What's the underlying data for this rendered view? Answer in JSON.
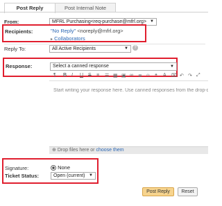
{
  "tabs": [
    {
      "label": "Post Reply",
      "active": true
    },
    {
      "label": "Post Internal Note",
      "active": false
    }
  ],
  "from": {
    "label": "From:",
    "value": "MFRL Purchasing<req-purchase@mfrl.org>"
  },
  "recipients": {
    "label": "Recipients:",
    "name": "\"No Reply\"",
    "email": "<noreply@mfrl.org>",
    "collaborators": "Collaborators"
  },
  "reply_to": {
    "label": "Reply To:",
    "value": "All Active Recipients"
  },
  "response": {
    "label": "Response:",
    "canned_placeholder": "Select a canned response",
    "editor_placeholder": "Start writing your response here. Use canned responses from the drop-down above"
  },
  "attachments": {
    "drop_text": "Drop files here or",
    "choose_link": "choose them"
  },
  "signature": {
    "label": "Signature:",
    "value": "None"
  },
  "ticket_status": {
    "label": "Ticket Status:",
    "value": "Open (current)"
  },
  "buttons": {
    "post": "Post Reply",
    "reset": "Reset"
  },
  "colors": {
    "highlight": "#e01e2e",
    "link": "#2a66b3",
    "primary_button": "#f7d48e"
  }
}
